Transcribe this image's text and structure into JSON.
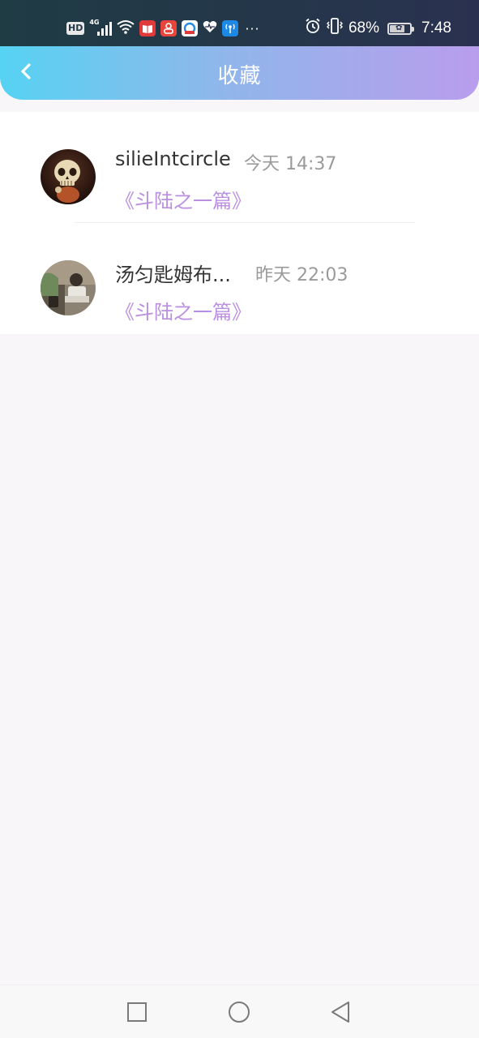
{
  "status_bar": {
    "network_badge": "HD",
    "network_type": "4G",
    "more": "···",
    "battery": "68%",
    "battery_level": 0.68,
    "time": "7:48",
    "icons": [
      "hd-icon",
      "signal-icon",
      "wifi-icon",
      "app-notification-icon",
      "alarm-icon",
      "vibrate-icon",
      "battery-icon"
    ]
  },
  "header": {
    "title": "收藏",
    "back_icon": "chevron-left-icon"
  },
  "favorites": [
    {
      "user": "silieIntcircle",
      "time": "今天 14:37",
      "work": "《斗陆之一篇》"
    },
    {
      "user": "汤匀匙姆布...",
      "time": "昨天 22:03",
      "work": "《斗陆之一篇》"
    }
  ],
  "colors": {
    "header_gradient_start": "#56d3f2",
    "header_gradient_end": "#b99ded",
    "accent_purple": "#bb8fe0",
    "status_bar_bg": "#25364a"
  },
  "nav": {
    "icons": [
      "square-icon",
      "circle-icon",
      "triangle-back-icon"
    ]
  }
}
